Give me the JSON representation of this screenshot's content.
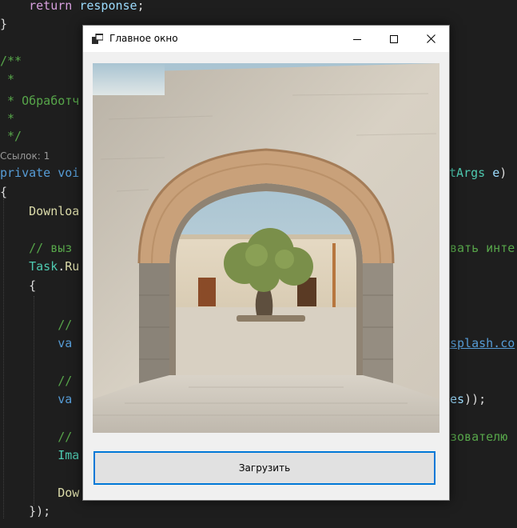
{
  "editor": {
    "lines": {
      "l1_kw": "return",
      "l1_ident": "response",
      "l1_end": ";",
      "l2": "}",
      "l3": "/**",
      "l4": " *",
      "l5": " * Обработч",
      "l6": " *",
      "l7": " */",
      "codelens": "Ссылок: 1",
      "l8_kw": "private",
      "l8_kw2": "voi",
      "l8_type": "ntArgs",
      "l8_ident": "e",
      "l8_end": ")",
      "l9": "{",
      "l10_fn": "Downloa",
      "l11_cmt": "// выз",
      "l11_cmt_right": "вать инте",
      "l12_type": "Task",
      "l12_dot": ".",
      "l12_fn": "Ru",
      "l13": "{",
      "l14_cmt": "//",
      "l15_kw": "va",
      "l15_url": "splash.co",
      "l16_cmt": "//",
      "l17_kw": "va",
      "l17_ident": "es",
      "l17_end": "));",
      "l18_cmt": "//",
      "l18_cmt_right": "зователю",
      "l19_type": "Ima",
      "l20_fn": "Dow",
      "l21": "});"
    }
  },
  "window": {
    "title": "Главное окно",
    "load_button_label": "Загрузить"
  },
  "icons": {
    "app": "window-app-icon",
    "minimize": "minimize-icon",
    "maximize": "maximize-icon",
    "close": "close-icon"
  },
  "colors": {
    "editor_bg": "#1e1e1e",
    "keyword": "#569cd6",
    "comment": "#57a64a",
    "type": "#4ec9b0",
    "button_focus_border": "#0078d7"
  }
}
